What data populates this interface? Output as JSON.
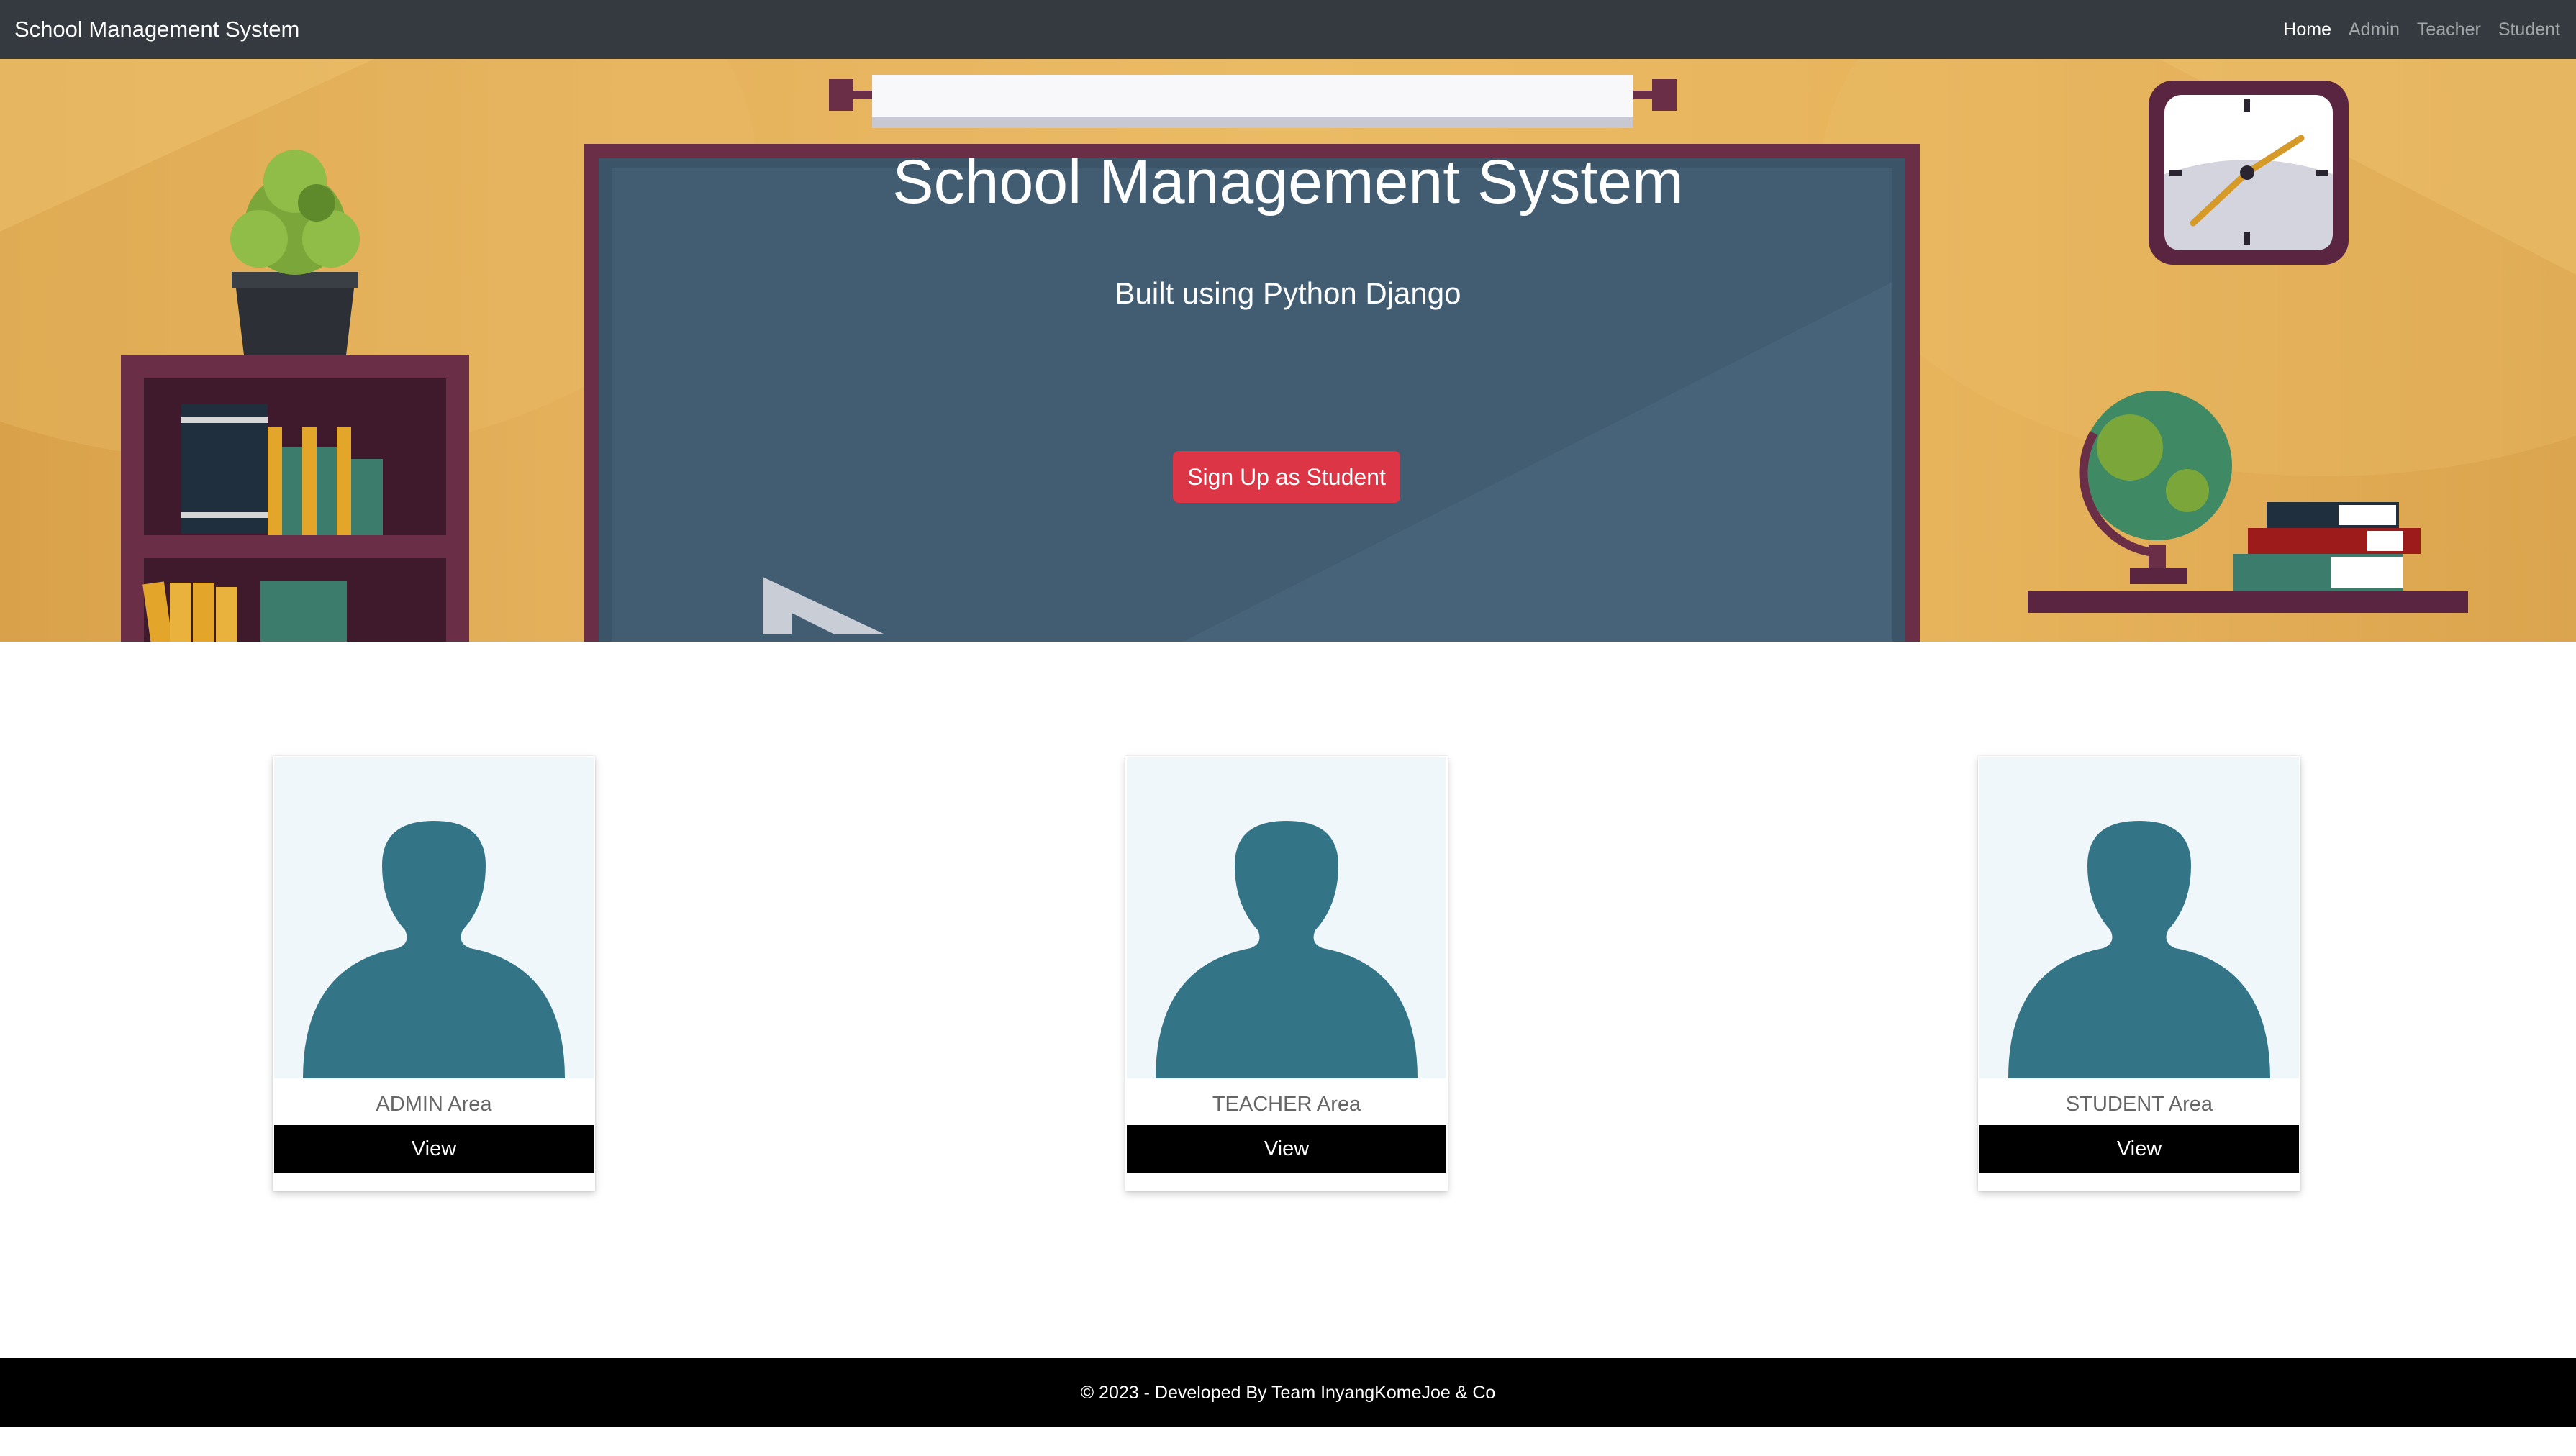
{
  "navbar": {
    "brand": "School Management System",
    "links": [
      {
        "label": "Home",
        "active": true
      },
      {
        "label": "Admin",
        "active": false
      },
      {
        "label": "Teacher",
        "active": false
      },
      {
        "label": "Student",
        "active": false
      }
    ]
  },
  "hero": {
    "title": "School Management System",
    "subtitle": "Built using Python Django",
    "signup_button": "Sign Up as Student"
  },
  "cards": [
    {
      "label": "ADMIN Area",
      "button": "View",
      "icon": "user-silhouette-icon"
    },
    {
      "label": "TEACHER Area",
      "button": "View",
      "icon": "user-silhouette-icon"
    },
    {
      "label": "STUDENT Area",
      "button": "View",
      "icon": "user-silhouette-icon"
    }
  ],
  "footer": {
    "text": "© 2023 - Developed By Team InyangKomeJoe & Co"
  },
  "colors": {
    "navbar": "#343a40",
    "hero_wall": "#e6b25d",
    "chalkboard": "#425d72",
    "signup_button": "#dc3545",
    "avatar": "#337487",
    "card_image_bg": "#f0f7fb",
    "card_button": "#000000",
    "footer": "#000000"
  }
}
